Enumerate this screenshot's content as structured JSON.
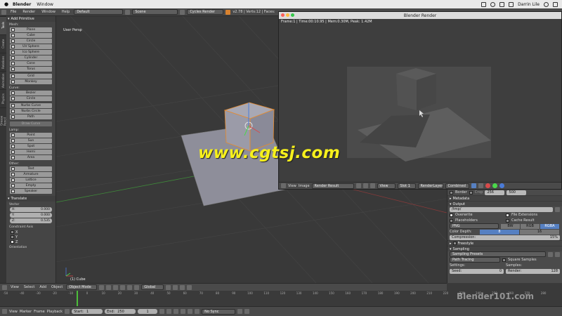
{
  "macbar": {
    "app": "Blender",
    "menu": [
      "Window"
    ],
    "user": "Darrin Lile"
  },
  "info": {
    "menus": [
      "File",
      "Render",
      "Window",
      "Help"
    ],
    "layout": "Default",
    "scene": "Scene",
    "engine": "Cycles Render",
    "version": "v2.78 | Verts:12 | Faces:"
  },
  "tabs": [
    "Tools",
    "Create",
    "Relations",
    "Animation",
    "Physics",
    "Grease Pencil"
  ],
  "shelf": {
    "panel_title": "Add Primitive",
    "mesh_label": "Mesh:",
    "mesh": [
      "Plane",
      "Cube",
      "Circle",
      "UV Sphere",
      "Ico Sphere",
      "Cylinder",
      "Cone",
      "Torus"
    ],
    "mesh2": [
      "Grid",
      "Monkey"
    ],
    "curve_label": "Curve:",
    "curve": [
      "Bezier",
      "Circle"
    ],
    "curve2": [
      "Nurbs Curve",
      "Nurbs Circle",
      "Path"
    ],
    "draw_curve": "Draw Curve",
    "lamp_label": "Lamp:",
    "lamp": [
      "Point",
      "Sun",
      "Spot",
      "Hemi",
      "Area"
    ],
    "other_label": "Other:",
    "other": [
      "Text",
      "Armature",
      "Lattice",
      "Empty",
      "Speaker"
    ],
    "translate_title": "Translate",
    "vector_label": "Vector",
    "vector": [
      {
        "k": "X:",
        "v": "0.000"
      },
      {
        "k": "Y:",
        "v": "0.000"
      },
      {
        "k": "Z:",
        "v": "0.535"
      }
    ],
    "constraint_label": "Constraint Axis",
    "axes": [
      "X",
      "Y",
      "Z"
    ],
    "orientation_label": "Orientation"
  },
  "viewport": {
    "label": "User Persp",
    "selection": "(1) Cube"
  },
  "render": {
    "title": "Blender Render",
    "stats": "Frame:1 | Time:00:10.95 | Mem:0.30M, Peak: 1.42M",
    "bar": {
      "view": "View",
      "image": "Image",
      "result": "Render Result",
      "view2": "View",
      "slot": "Slot 1",
      "layer": "RenderLayer",
      "pass": "Combined"
    }
  },
  "props": {
    "border_label": "Border",
    "crop_label": "Crop",
    "size1": "256",
    "size2": "500",
    "metadata": "Metadata",
    "output": "Output",
    "path": "/tmp/",
    "overwrite": "Overwrite",
    "file_ext": "File Extensions",
    "placeholders": "Placeholders",
    "cache": "Cache Result",
    "format": "PNG",
    "bw": "BW",
    "rgb": "RGB",
    "rgba": "RGBA",
    "color_depth": "Color Depth:",
    "depth8": "8",
    "depth16": "16",
    "compression": "Compression:",
    "compression_val": "15%",
    "freestyle": "Freestyle",
    "sampling": "Sampling",
    "presets": "Sampling Presets",
    "path_tracing": "Path Tracing",
    "square": "Square Samples",
    "settings": "Settings:",
    "samples": "Samples:",
    "seed": "Seed:",
    "seed_val": "0",
    "render_s": "Render:",
    "render_val": "128"
  },
  "v3header": {
    "menus": [
      "View",
      "Select",
      "Add",
      "Object"
    ],
    "mode": "Object Mode",
    "orientation": "Global"
  },
  "timeline": {
    "ticks": [
      "-50",
      "-40",
      "-30",
      "-20",
      "-10",
      "0",
      "10",
      "20",
      "30",
      "40",
      "50",
      "60",
      "70",
      "80",
      "90",
      "100",
      "110",
      "120",
      "130",
      "140",
      "150",
      "160",
      "170",
      "180",
      "190",
      "200",
      "210",
      "220",
      "230",
      "240",
      "250",
      "260",
      "270",
      "280"
    ],
    "menus": [
      "View",
      "Marker",
      "Frame",
      "Playback"
    ],
    "start_label": "Start:",
    "start": "1",
    "end_label": "End:",
    "end": "250",
    "current": "1",
    "sync": "No Sync"
  },
  "watermark": "www.cgtsj.com",
  "watermark2": "Blender101.com",
  "colors": {
    "accent": "#d8822f",
    "selection": "#5680c2",
    "watermark": "#f6f01c"
  }
}
